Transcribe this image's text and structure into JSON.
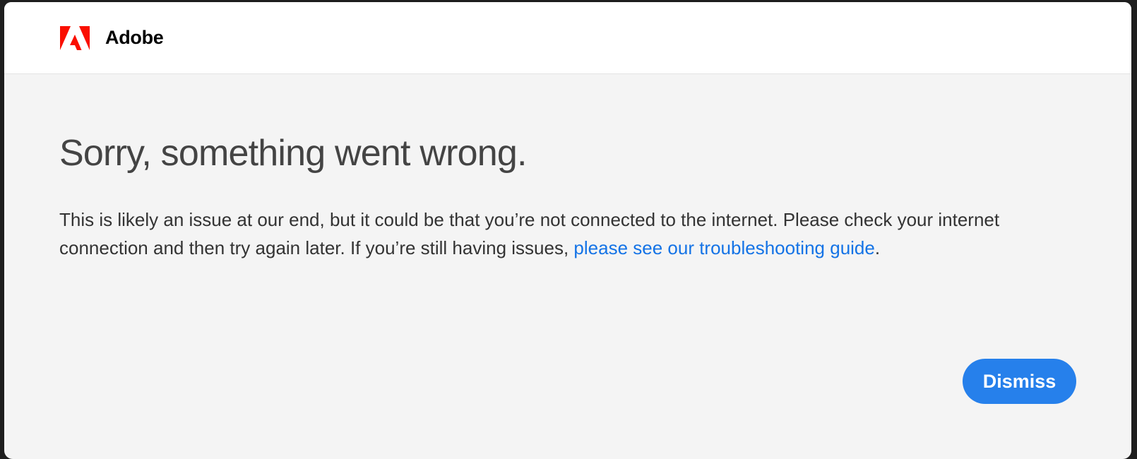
{
  "header": {
    "brand_name": "Adobe",
    "logo_icon": "adobe-logo-icon",
    "brand_color": "#FA0F00"
  },
  "error": {
    "title": "Sorry, something went wrong.",
    "message_part1": "This is likely an issue at our end, but it could be that you’re not connected to the internet. Please check your internet connection and then try again later. If you’re still having issues, ",
    "link_text": "please see our troubleshooting guide",
    "message_end": "."
  },
  "actions": {
    "dismiss_label": "Dismiss",
    "accent_color": "#2680EB",
    "link_color": "#1473E6"
  }
}
